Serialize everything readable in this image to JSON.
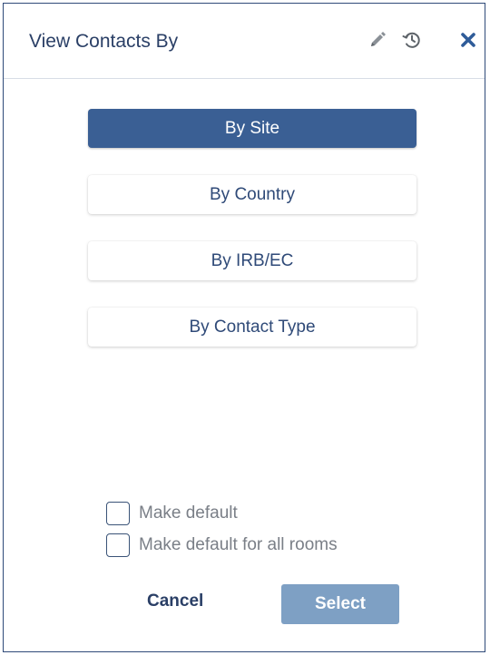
{
  "dialog": {
    "title": "View Contacts By",
    "icons": [
      "pencil-icon",
      "history-icon",
      "close-icon"
    ],
    "options": [
      {
        "label": "By Site",
        "selected": true
      },
      {
        "label": "By Country",
        "selected": false
      },
      {
        "label": "By IRB/EC",
        "selected": false
      },
      {
        "label": "By Contact Type",
        "selected": false
      }
    ],
    "checkboxes": [
      {
        "label": "Make default",
        "checked": false
      },
      {
        "label": "Make default for all rooms",
        "checked": false
      }
    ],
    "cancel_label": "Cancel",
    "select_label": "Select"
  },
  "colors": {
    "primary": "#3a5f94",
    "title": "#2a3f66",
    "select_disabled": "#7ea0c4"
  }
}
